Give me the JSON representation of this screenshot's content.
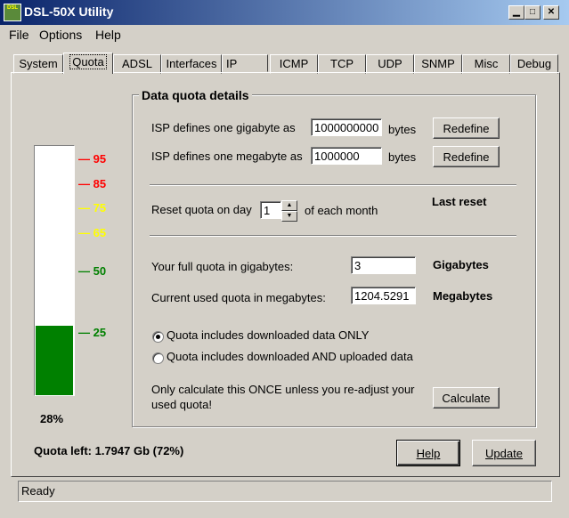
{
  "window": {
    "title": "DSL-50X Utility",
    "icon_text": "DSL"
  },
  "menu": {
    "file": "File",
    "options": "Options",
    "help": "Help"
  },
  "tabs": [
    "System",
    "Quota",
    "ADSL",
    "Interfaces",
    "IP",
    "ICMP",
    "TCP",
    "UDP",
    "SNMP",
    "Misc",
    "Debug"
  ],
  "active_tab": "Quota",
  "gauge": {
    "ticks": [
      "95",
      "85",
      "75",
      "65",
      "50",
      "25"
    ],
    "tick_colors": [
      "#ff0000",
      "#ff0000",
      "#ffff00",
      "#ffff00",
      "#008000",
      "#008000"
    ],
    "fill_fraction": 0.28,
    "fill_color": "#008000",
    "percent_label": "28%"
  },
  "quota_left": "Quota left: 1.7947 Gb (72%)",
  "group": {
    "title": "Data quota details",
    "gigabyte_label": "ISP defines one gigabyte as",
    "gigabyte_value": "1000000000",
    "gigabyte_unit": "bytes",
    "megabyte_label": "ISP defines one megabyte as",
    "megabyte_value": "1000000",
    "megabyte_unit": "bytes",
    "redefine": "Redefine",
    "reset_label": "Reset quota on day",
    "reset_day": "1",
    "reset_suffix": "of each month",
    "last_reset": "Last reset",
    "full_quota_label": "Your full quota in gigabytes:",
    "full_quota_value": "3",
    "full_quota_unit": "Gigabytes",
    "used_label": "Current used quota in megabytes:",
    "used_value": "1204.5291",
    "used_unit": "Megabytes",
    "radio_download": "Quota includes downloaded data ONLY",
    "radio_both": "Quota includes downloaded AND uploaded data",
    "calc_note_1": "Only calculate this ONCE unless you re-adjust your",
    "calc_note_2": "used quota!",
    "calculate": "Calculate"
  },
  "buttons": {
    "help": "Help",
    "update": "Update"
  },
  "status": "Ready"
}
